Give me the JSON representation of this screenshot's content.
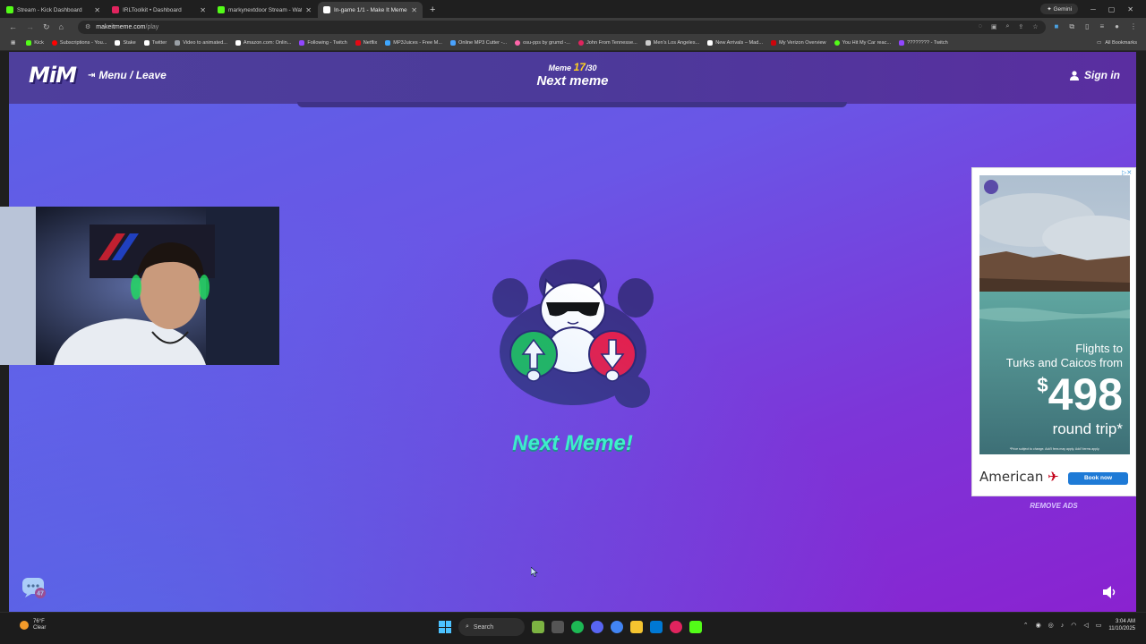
{
  "browser": {
    "tabs": [
      {
        "title": "Stream - Kick Dashboard",
        "color": "#53fc18",
        "active": false
      },
      {
        "title": "IRLToolkit • Dashboard",
        "color": "#e0245e",
        "active": false
      },
      {
        "title": "markynextdoor Stream - Watch",
        "color": "#53fc18",
        "active": false
      },
      {
        "title": "In-game 1/1 - Make It Meme",
        "color": "#ffffff",
        "active": true
      }
    ],
    "new_tab_icon": "+",
    "gemini_label": "Gemini",
    "url_host": "makeitmeme.com",
    "url_path": "/play",
    "bookmarks": [
      {
        "label": "Kick",
        "color": "#53fc18"
      },
      {
        "label": "Subscriptions - You...",
        "color": "#ff0000"
      },
      {
        "label": "Stake",
        "color": "#ffffff"
      },
      {
        "label": "Twitter",
        "color": "#ffffff"
      },
      {
        "label": "Video to animated...",
        "color": "#9aa0a6"
      },
      {
        "label": "Amazon.com: Onlin...",
        "color": "#ffffff"
      },
      {
        "label": "Following - Twitch",
        "color": "#9146ff"
      },
      {
        "label": "Netflix",
        "color": "#e50914"
      },
      {
        "label": "MP3Juices - Free M...",
        "color": "#3ea6ff"
      },
      {
        "label": "Online MP3 Cutter -...",
        "color": "#4aa3ff"
      },
      {
        "label": "osu-pps by grumd -...",
        "color": "#ff66aa"
      },
      {
        "label": "John From Tennesse...",
        "color": "#e0245e"
      },
      {
        "label": "Men's Los Angeles...",
        "color": "#cccccc"
      },
      {
        "label": "New Arrivals – Mad...",
        "color": "#ffffff"
      },
      {
        "label": "My Verizon Overview",
        "color": "#cd040b"
      },
      {
        "label": "You Hit My Car reac...",
        "color": "#53fc18"
      },
      {
        "label": "???????? - Twitch",
        "color": "#9146ff"
      }
    ],
    "all_bookmarks": "All Bookmarks"
  },
  "site": {
    "logo": "MiM",
    "menu_leave": "Menu / Leave",
    "meme_label": "Meme",
    "meme_current": "17",
    "meme_total": "/30",
    "title": "Next meme",
    "sign_in": "Sign in",
    "next_meme_text": "Next Meme!",
    "remove_ads": "REMOVE ADS",
    "chat_badge": "47"
  },
  "ad": {
    "line1": "Flights to",
    "line2": "Turks and Caicos from",
    "currency": "$",
    "price": "498",
    "trip": "round trip*",
    "fine_print": "*Price subject to change. Add'l fees may apply. Add'l terms apply.",
    "brand": "American",
    "cta": "Book now"
  },
  "taskbar": {
    "temp": "76°F",
    "weather": "Clear",
    "search": "Search",
    "time": "3:04 AM",
    "date": "11/10/2025"
  },
  "colors": {
    "accent_green": "#3fffc4",
    "counter_yellow": "#ffd21f",
    "ad_blue": "#1e7ad6"
  }
}
